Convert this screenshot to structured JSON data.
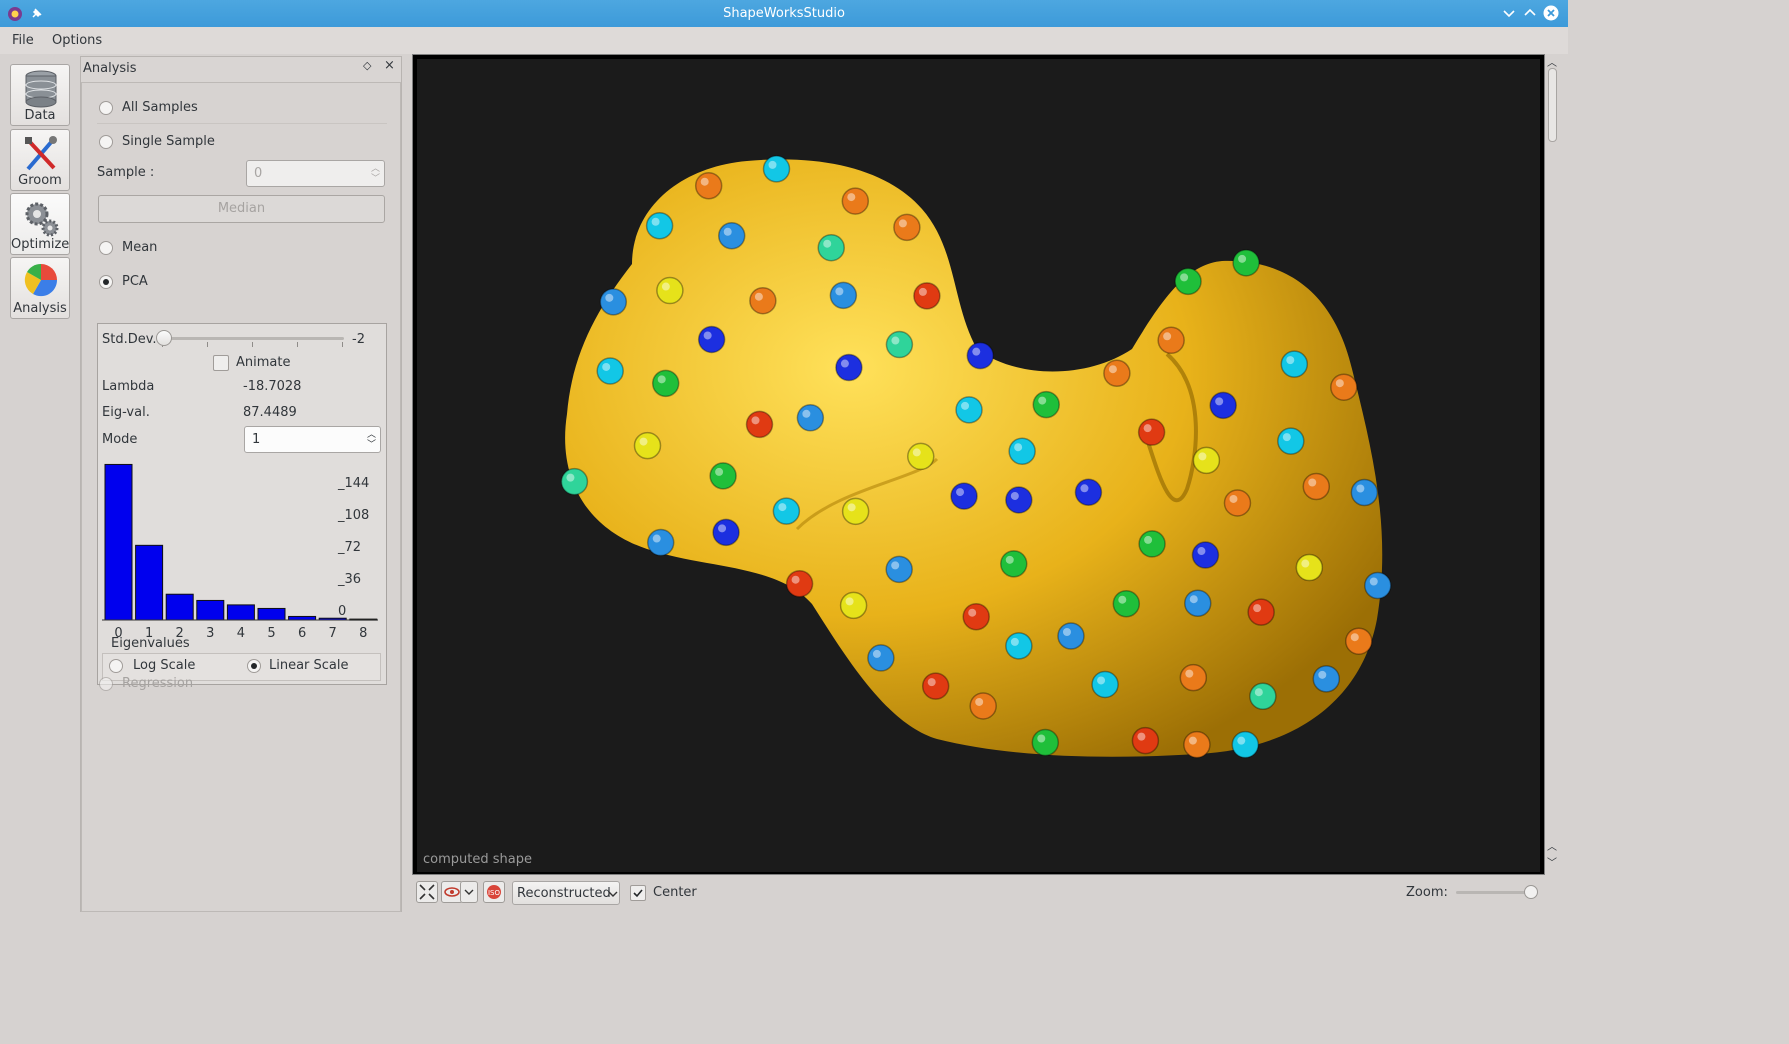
{
  "window": {
    "title": "ShapeWorksStudio"
  },
  "menu": {
    "file": "File",
    "options": "Options"
  },
  "tools": [
    {
      "label": "Data",
      "icon": "database-icon"
    },
    {
      "label": "Groom",
      "icon": "tools-icon"
    },
    {
      "label": "Optimize",
      "icon": "gears-icon"
    },
    {
      "label": "Analysis",
      "icon": "pie-chart-icon"
    }
  ],
  "panel": {
    "title": "Analysis",
    "all_samples": "All Samples",
    "single_sample": "Single Sample",
    "sample_label": "Sample :",
    "sample_value": "0",
    "median": "Median",
    "mean": "Mean",
    "pca": "PCA",
    "stddev_label": "Std.Dev.",
    "stddev_value": "-2",
    "stddev_fraction": 0.0,
    "animate": "Animate",
    "lambda_label": "Lambda",
    "lambda_value": "-18.7028",
    "eigval_label": "Eig-val.",
    "eigval_value": "87.4489",
    "mode_label": "Mode",
    "mode_value": "1",
    "log_scale": "Log Scale",
    "linear_scale": "Linear Scale",
    "regression": "Regression"
  },
  "chart_data": {
    "type": "bar",
    "title": "",
    "xlabel": "Eigenvalues",
    "ylabel": "",
    "categories": [
      "0",
      "1",
      "2",
      "3",
      "4",
      "5",
      "6",
      "7",
      "8"
    ],
    "values": [
      175,
      84,
      29,
      22,
      17,
      13,
      4,
      2,
      1
    ],
    "ylim": [
      0,
      180
    ],
    "yticks": [
      "_144",
      "_108",
      "_72",
      "_36",
      "0"
    ],
    "ytick_values": [
      144,
      108,
      72,
      36,
      0
    ],
    "color": "#0000ee"
  },
  "viewer": {
    "caption": "computed shape",
    "display_mode": "Reconstructed",
    "center_label": "Center",
    "zoom_label": "Zoom:",
    "zoom_fraction": 0.95,
    "surface_color": "#e8b21a",
    "background_color": "#1b1b1b"
  }
}
